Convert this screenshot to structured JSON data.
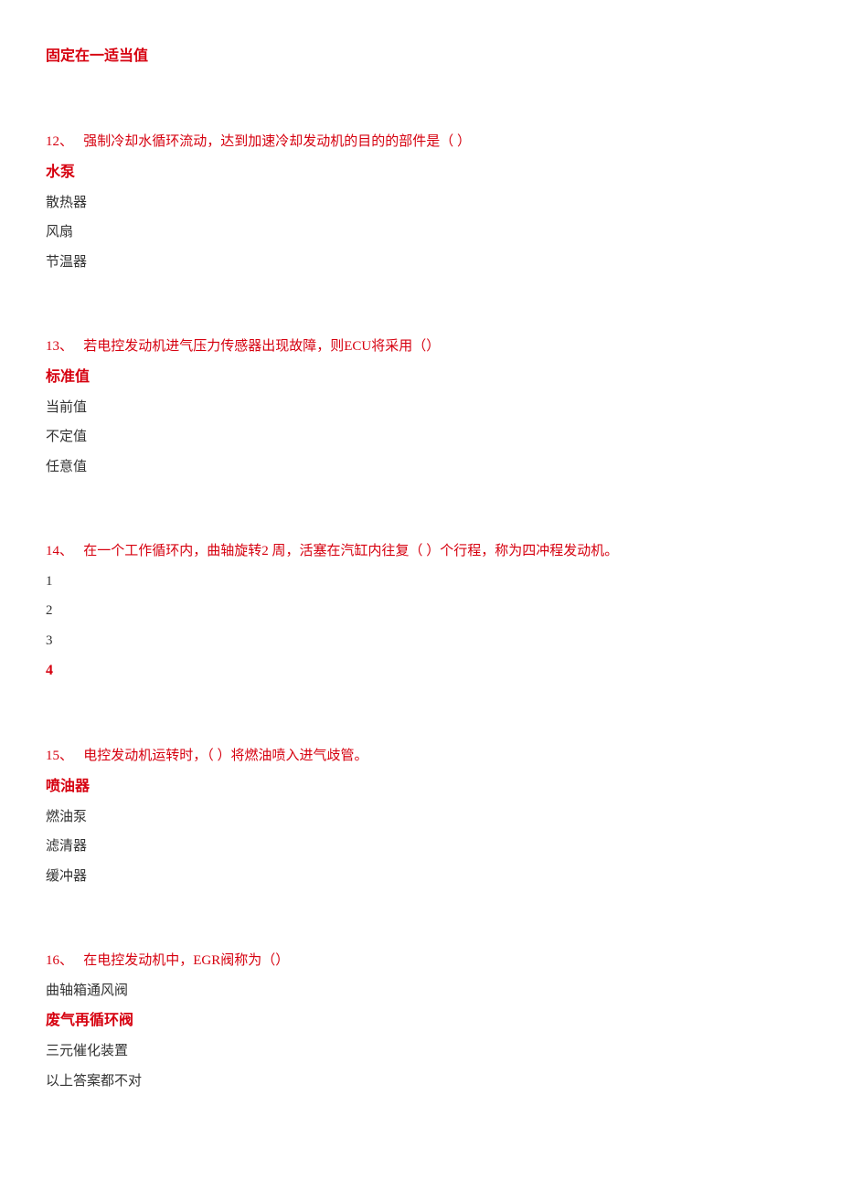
{
  "heading_answer": "固定在一适当值",
  "questions": [
    {
      "number": "12、",
      "text": "强制冷却水循环流动，达到加速冷却发动机的目的的部件是（ ）",
      "options": [
        {
          "label": "水泵",
          "correct": true
        },
        {
          "label": "散热器",
          "correct": false
        },
        {
          "label": "风扇",
          "correct": false
        },
        {
          "label": "节温器",
          "correct": false
        }
      ]
    },
    {
      "number": "13、",
      "text": "若电控发动机进气压力传感器出现故障，则ECU将采用（）",
      "options": [
        {
          "label": "标准值",
          "correct": true
        },
        {
          "label": "当前值",
          "correct": false
        },
        {
          "label": "不定值",
          "correct": false
        },
        {
          "label": "任意值",
          "correct": false
        }
      ]
    },
    {
      "number": "14、",
      "text": "在一个工作循环内，曲轴旋转2 周，活塞在汽缸内往复（ ）个行程，称为四冲程发动机。",
      "options": [
        {
          "label": "1",
          "correct": false
        },
        {
          "label": "2",
          "correct": false
        },
        {
          "label": "3",
          "correct": false
        },
        {
          "label": "4",
          "correct": true
        }
      ]
    },
    {
      "number": "15、",
      "text": "电控发动机运转时，（ ）将燃油喷入进气歧管。",
      "options": [
        {
          "label": "喷油器",
          "correct": true
        },
        {
          "label": "燃油泵",
          "correct": false
        },
        {
          "label": "滤清器",
          "correct": false
        },
        {
          "label": "缓冲器",
          "correct": false
        }
      ]
    },
    {
      "number": "16、",
      "text": "在电控发动机中，EGR阀称为（）",
      "options": [
        {
          "label": "曲轴箱通风阀",
          "correct": false
        },
        {
          "label": "废气再循环阀",
          "correct": true
        },
        {
          "label": "三元催化装置",
          "correct": false
        },
        {
          "label": "以上答案都不对",
          "correct": false
        }
      ]
    }
  ]
}
